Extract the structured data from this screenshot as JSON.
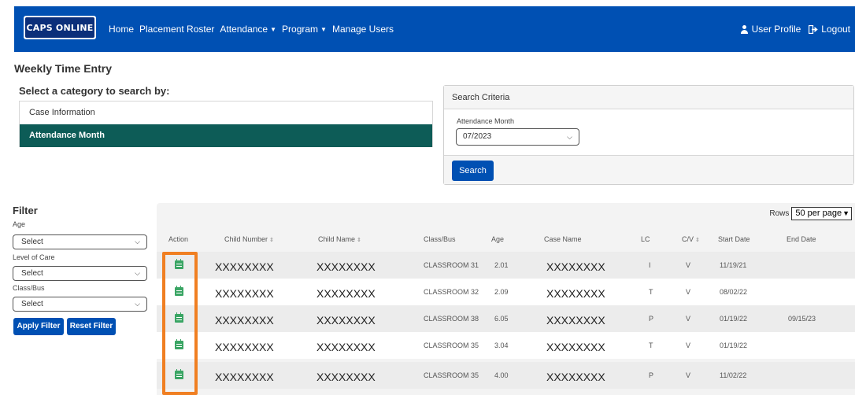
{
  "nav": {
    "logo": "CAPS ONLINE",
    "links": [
      "Home",
      "Placement Roster",
      "Attendance",
      "Program",
      "Manage Users"
    ],
    "user_profile": "User Profile",
    "logout": "Logout"
  },
  "page_title": "Weekly Time Entry",
  "category": {
    "label": "Select a category to search by:",
    "items": [
      "Case Information",
      "Attendance Month"
    ],
    "selected": "Attendance Month"
  },
  "search_criteria": {
    "title": "Search Criteria",
    "field_label": "Attendance Month",
    "field_value": "07/2023",
    "button": "Search"
  },
  "filter": {
    "title": "Filter",
    "age_label": "Age",
    "age_value": "Select",
    "loc_label": "Level of Care",
    "loc_value": "Select",
    "class_label": "Class/Bus",
    "class_value": "Select",
    "apply": "Apply Filter",
    "reset": "Reset Filter"
  },
  "table": {
    "rows_label": "Rows",
    "rows_value": "50 per page",
    "headers": [
      "Action",
      "Child Number",
      "Child Name",
      "Class/Bus",
      "Age",
      "Case Name",
      "LC",
      "C/V",
      "Start Date",
      "End Date"
    ],
    "rows": [
      {
        "child_number": "XXXXXXXX",
        "child_name": "XXXXXXXX",
        "class_bus": "CLASSROOM 31",
        "age": "2.01",
        "case_name": "XXXXXXXX",
        "lc": "I",
        "cv": "V",
        "start": "11/19/21",
        "end": ""
      },
      {
        "child_number": "XXXXXXXX",
        "child_name": "XXXXXXXX",
        "class_bus": "CLASSROOM 32",
        "age": "2.09",
        "case_name": "XXXXXXXX",
        "lc": "T",
        "cv": "V",
        "start": "08/02/22",
        "end": ""
      },
      {
        "child_number": "XXXXXXXX",
        "child_name": "XXXXXXXX",
        "class_bus": "CLASSROOM 38",
        "age": "6.05",
        "case_name": "XXXXXXXX",
        "lc": "P",
        "cv": "V",
        "start": "01/19/22",
        "end": "09/15/23"
      },
      {
        "child_number": "XXXXXXXX",
        "child_name": "XXXXXXXX",
        "class_bus": "CLASSROOM 35",
        "age": "3.04",
        "case_name": "XXXXXXXX",
        "lc": "T",
        "cv": "V",
        "start": "01/19/22",
        "end": ""
      },
      {
        "child_number": "XXXXXXXX",
        "child_name": "XXXXXXXX",
        "class_bus": "CLASSROOM 35",
        "age": "4.00",
        "case_name": "XXXXXXXX",
        "lc": "P",
        "cv": "V",
        "start": "11/02/22",
        "end": ""
      }
    ]
  },
  "colors": {
    "nav": "#0050b3",
    "active_category": "#0d5c57",
    "action_icon": "#3aa564",
    "highlight": "#f07f22"
  },
  "icons": {
    "action": "calendar-icon",
    "user": "user-icon",
    "logout": "logout-icon"
  }
}
